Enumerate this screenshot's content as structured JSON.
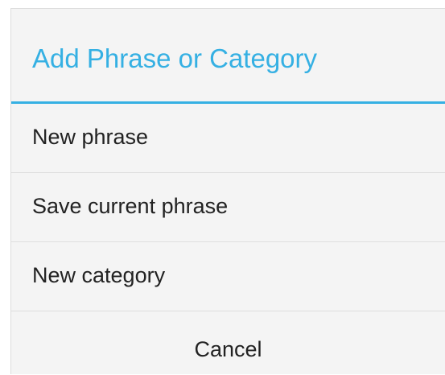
{
  "dialog": {
    "title": "Add Phrase or Category",
    "accent_color": "#35b0e3",
    "items": [
      {
        "label": "New phrase"
      },
      {
        "label": "Save current phrase"
      },
      {
        "label": "New category"
      }
    ],
    "cancel_label": "Cancel"
  }
}
